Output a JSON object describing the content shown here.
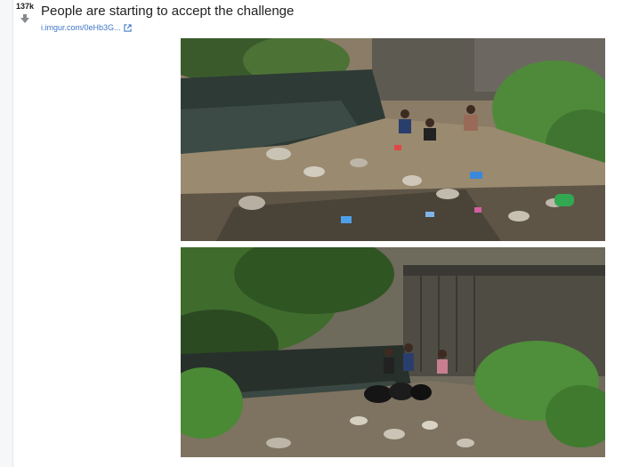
{
  "post": {
    "score": "137k",
    "title": "People are starting to accept the challenge",
    "domain": "i.imgur.com/0eHb3G...",
    "link_icon": "external-link-icon",
    "vote_icon": "downvote-arrow-icon"
  },
  "images": {
    "before": {
      "content": "creek-with-trash-before-photo"
    },
    "after": {
      "content": "creek-cleaned-after-photo"
    }
  },
  "colors": {
    "link": "#3d77c7",
    "title": "#222222",
    "strip_bg": "#f6f7f8"
  }
}
